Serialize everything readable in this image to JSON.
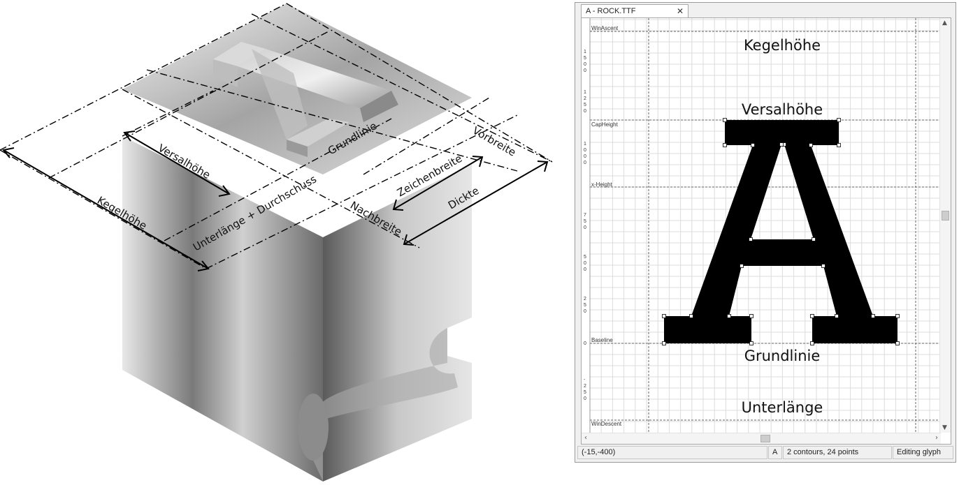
{
  "isometric": {
    "labels": {
      "kegelhoehe": "Kegelhöhe",
      "versalhoehe": "Versalhöhe",
      "unterlaenge_durchschuss": "Unterlänge + Durchschuss",
      "grundlinie": "Grundlinie",
      "zeichenbreite": "Zeichenbreite",
      "vorbreite": "Vorbreite",
      "nachbreite": "Nachbreite",
      "dickte": "Dickte"
    },
    "glyph_char": "A"
  },
  "editor": {
    "tab_title": "A - ROCK.TTF",
    "tab_close": "✕",
    "guides": {
      "win_ascent": "WinAscent",
      "cap_height": "CapHeight",
      "x_height": "x-Height",
      "baseline": "Baseline",
      "win_descent": "WinDescent"
    },
    "overlay_labels": {
      "kegelhoehe": "Kegelhöhe",
      "versalhoehe": "Versalhöhe",
      "grundlinie": "Grundlinie",
      "unterlaenge": "Unterlänge"
    },
    "ruler_labels": [
      "1500",
      "1250",
      "1000",
      "750",
      "500",
      "250",
      "0",
      "-250"
    ],
    "scroll_arrows": {
      "up": "▲",
      "down": "▼",
      "left": "‹",
      "right": "›"
    },
    "status": {
      "coordinates": "(-15,-400)",
      "glyph": "A",
      "contours": "2 contours, 24 points",
      "mode": "Editing glyph"
    }
  }
}
